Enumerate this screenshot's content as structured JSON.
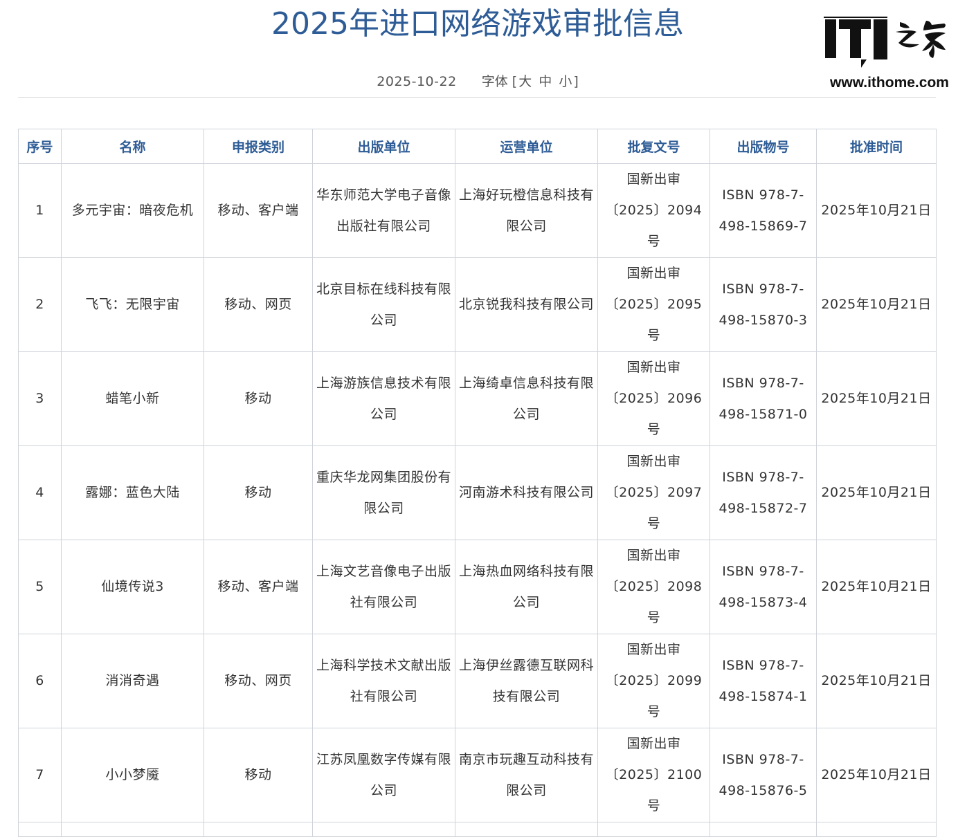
{
  "article": {
    "title": "2025年进口网络游戏审批信息",
    "date": "2025-10-22",
    "font_label": "字体",
    "bracket_open": "[",
    "bracket_close": "]",
    "font_large": "大",
    "font_medium": "中",
    "font_small": "小"
  },
  "logo": {
    "text": "IT之家",
    "url": "www.ithome.com"
  },
  "table": {
    "headers": [
      "序号",
      "名称",
      "申报类别",
      "出版单位",
      "运营单位",
      "批复文号",
      "出版物号",
      "批准时间"
    ],
    "rows": [
      [
        "1",
        "多元宇宙：暗夜危机",
        "移动、客户端",
        "华东师范大学电子音像出版社有限公司",
        "上海好玩橙信息科技有限公司",
        "国新出审〔2025〕2094号",
        "ISBN 978-7-498-15869-7",
        "2025年10月21日"
      ],
      [
        "2",
        "飞飞：无限宇宙",
        "移动、网页",
        "北京目标在线科技有限公司",
        "北京锐我科技有限公司",
        "国新出审〔2025〕2095号",
        "ISBN 978-7-498-15870-3",
        "2025年10月21日"
      ],
      [
        "3",
        "蜡笔小新",
        "移动",
        "上海游族信息技术有限公司",
        "上海绮卓信息科技有限公司",
        "国新出审〔2025〕2096号",
        "ISBN 978-7-498-15871-0",
        "2025年10月21日"
      ],
      [
        "4",
        "露娜：蓝色大陆",
        "移动",
        "重庆华龙网集团股份有限公司",
        "河南游术科技有限公司",
        "国新出审〔2025〕2097号",
        "ISBN 978-7-498-15872-7",
        "2025年10月21日"
      ],
      [
        "5",
        "仙境传说3",
        "移动、客户端",
        "上海文艺音像电子出版社有限公司",
        "上海热血网络科技有限公司",
        "国新出审〔2025〕2098号",
        "ISBN 978-7-498-15873-4",
        "2025年10月21日"
      ],
      [
        "6",
        "消消奇遇",
        "移动、网页",
        "上海科学技术文献出版社有限公司",
        "上海伊丝露德互联网科技有限公司",
        "国新出审〔2025〕2099号",
        "ISBN 978-7-498-15874-1",
        "2025年10月21日"
      ],
      [
        "7",
        "小小梦魇",
        "移动",
        "江苏凤凰数字传媒有限公司",
        "南京市玩趣互动科技有限公司",
        "国新出审〔2025〕2100号",
        "ISBN 978-7-498-15876-5",
        "2025年10月21日"
      ]
    ]
  },
  "colors": {
    "title_blue": "#2e5c96",
    "border": "#cfd3da",
    "text": "#333333"
  }
}
